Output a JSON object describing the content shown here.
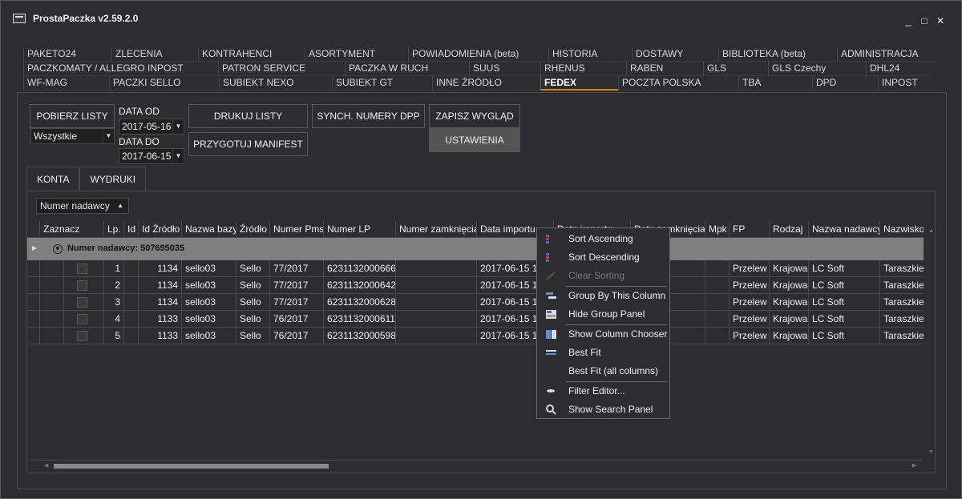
{
  "window": {
    "title": "ProstaPaczka v2.59.2.0",
    "controls": [
      "_",
      "□",
      "✕"
    ]
  },
  "tabs": {
    "row1": [
      "PAKETO24",
      "ZLECENIA",
      "KONTRAHENCI",
      "ASORTYMENT",
      "POWIADOMIENIA (beta)",
      "HISTORIA",
      "DOSTAWY",
      "BIBLIOTEKA (beta)",
      "ADMINISTRACJA"
    ],
    "row2": [
      "PACZKOMATY / ALLEGRO INPOST",
      "PATRON SERVICE",
      "PACZKA W RUCH",
      "SUUS",
      "RHENUS",
      "RABEN",
      "GLS",
      "GLS Czechy",
      "DHL24"
    ],
    "row3": [
      "WF-MAG",
      "PACZKI SELLO",
      "SUBIEKT NEXO",
      "SUBIEKT GT",
      "INNE ŹRÓDŁO",
      "FEDEX",
      "POCZTA POLSKA",
      "TBA",
      "DPD",
      "INPOST"
    ],
    "active": "FEDEX"
  },
  "toolbar": {
    "pobierz": "POBIERZ LISTY",
    "filter_value": "Wszystkie",
    "data_od_label": "DATA OD",
    "data_od": "2017-05-16",
    "data_do_label": "DATA DO",
    "data_do": "2017-06-15",
    "drukuj": "DRUKUJ LISTY",
    "manifest": "PRZYGOTUJ MANIFEST",
    "synch": "SYNCH. NUMERY DPP",
    "zapisz": "ZAPISZ WYGLĄD",
    "ustawienia": "USTAWIENIA"
  },
  "subtabs": [
    "KONTA",
    "WYDRUKI"
  ],
  "group_panel": {
    "field": "Numer nadawcy"
  },
  "grid": {
    "columns": [
      "Zaznacz",
      "Lp.",
      "Id",
      "Id Źródło",
      "Nazwa bazy",
      "Źródło",
      "Numer Pms",
      "Numer LP",
      "Numer zamknięcia",
      "Data importu",
      "Data importu",
      "Data zamknięcia",
      "Mpk",
      "FP",
      "Rodzaj",
      "Nazwa nadawcy",
      "Nazwisko"
    ],
    "col_label_data_import2": "Data importu",
    "col_label_zamkniecia": "Data zamknięcia",
    "group_label": "Numer nadawcy: 507695035",
    "rows": [
      {
        "lp": "1",
        "id_zrodlo": "1134",
        "baza": "sello03",
        "zrodlo": "Sello",
        "pms": "77/2017",
        "lpnum": "6231132000666",
        "data": "2017-06-15 16",
        "fp": "Przelew",
        "rodzaj": "Krajowa",
        "nadawca": "LC Soft",
        "nazwisko": "Taraszkie"
      },
      {
        "lp": "2",
        "id_zrodlo": "1134",
        "baza": "sello03",
        "zrodlo": "Sello",
        "pms": "77/2017",
        "lpnum": "6231132000642",
        "data": "2017-06-15 16",
        "fp": "Przelew",
        "rodzaj": "Krajowa",
        "nadawca": "LC Soft",
        "nazwisko": "Taraszkie"
      },
      {
        "lp": "3",
        "id_zrodlo": "1134",
        "baza": "sello03",
        "zrodlo": "Sello",
        "pms": "77/2017",
        "lpnum": "6231132000628",
        "data": "2017-06-15 16",
        "fp": "Przelew",
        "rodzaj": "Krajowa",
        "nadawca": "LC Soft",
        "nazwisko": "Taraszkie"
      },
      {
        "lp": "4",
        "id_zrodlo": "1133",
        "baza": "sello03",
        "zrodlo": "Sello",
        "pms": "76/2017",
        "lpnum": "6231132000611",
        "data": "2017-06-15 16",
        "fp": "Przelew",
        "rodzaj": "Krajowa",
        "nadawca": "LC Soft",
        "nazwisko": "Taraszkie"
      },
      {
        "lp": "5",
        "id_zrodlo": "1133",
        "baza": "sello03",
        "zrodlo": "Sello",
        "pms": "76/2017",
        "lpnum": "6231132000598",
        "data": "2017-06-15 16",
        "fp": "Przelew",
        "rodzaj": "Krajowa",
        "nadawca": "LC Soft",
        "nazwisko": "Taraszkie"
      }
    ]
  },
  "context_menu": {
    "sort_asc": "Sort Ascending",
    "sort_desc": "Sort Descending",
    "clear_sort": "Clear Sorting",
    "group_by": "Group By This Column",
    "hide_group": "Hide Group Panel",
    "col_chooser": "Show Column Chooser",
    "best_fit": "Best Fit",
    "best_fit_all": "Best Fit (all columns)",
    "filter_editor": "Filter Editor...",
    "search_panel": "Show Search Panel"
  }
}
